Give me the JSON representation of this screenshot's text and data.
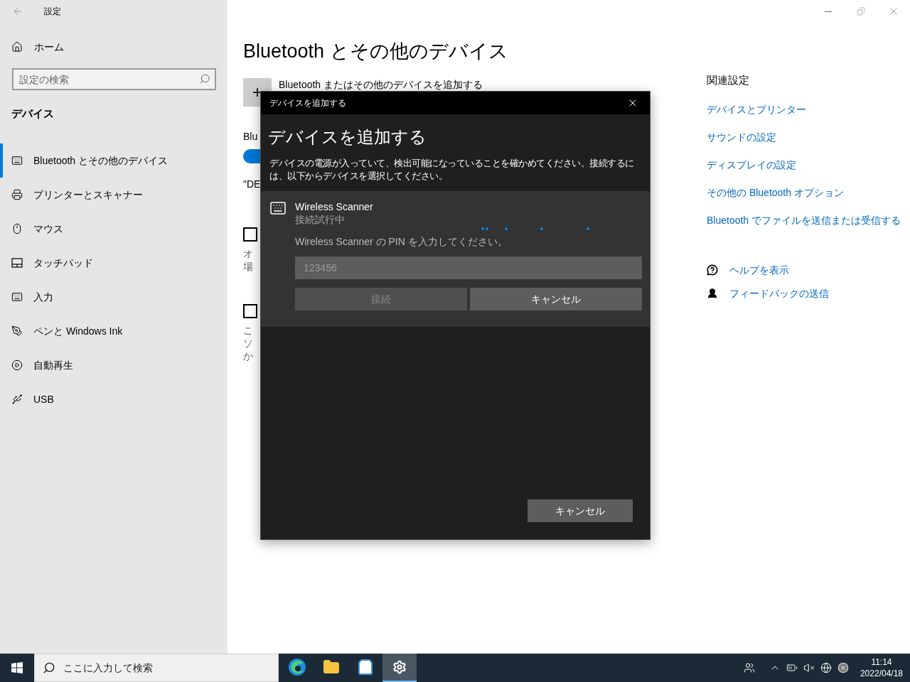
{
  "window": {
    "title": "設定"
  },
  "sidebar": {
    "home": "ホーム",
    "search": {
      "placeholder": "設定の検索"
    },
    "section": "デバイス",
    "items": [
      {
        "label": "Bluetooth とその他のデバイス",
        "selected": true
      },
      {
        "label": "プリンターとスキャナー",
        "selected": false
      },
      {
        "label": "マウス",
        "selected": false
      },
      {
        "label": "タッチパッド",
        "selected": false
      },
      {
        "label": "入力",
        "selected": false
      },
      {
        "label": "ペンと Windows Ink",
        "selected": false
      },
      {
        "label": "自動再生",
        "selected": false
      },
      {
        "label": "USB",
        "selected": false
      }
    ]
  },
  "main": {
    "title": "Bluetooth とその他のデバイス",
    "add_button": {
      "glyph": "+",
      "label": "Bluetooth またはその他のデバイスを追加する"
    },
    "bluetooth_label": "Blu",
    "bluetooth_toggle": {
      "on": true
    },
    "discoverable_text": "\"DE",
    "checkboxes": [
      {
        "checked": false,
        "lines": [
          "オ",
          "場"
        ]
      },
      {
        "checked": false,
        "lines": [
          "こ",
          "ソ",
          "か"
        ]
      }
    ]
  },
  "related": {
    "heading": "関連設定",
    "links": [
      "デバイスとプリンター",
      "サウンドの設定",
      "ディスプレイの設定",
      "その他の Bluetooth オプション",
      "Bluetooth でファイルを送信または受信する"
    ],
    "help": [
      "ヘルプを表示",
      "フィードバックの送信"
    ]
  },
  "dialog": {
    "title": "デバイスを追加する",
    "heading": "デバイスを追加する",
    "description": "デバイスの電源が入っていて、検出可能になっていることを確かめてください。接続するには、以下からデバイスを選択してください。",
    "device": {
      "name": "Wireless Scanner",
      "status": "接続試行中",
      "prompt": "Wireless Scanner の PIN を入力してください。",
      "pin": {
        "placeholder": "123456"
      },
      "buttons": [
        {
          "label": "接続",
          "disabled": true
        },
        {
          "label": "キャンセル",
          "disabled": false
        }
      ]
    },
    "cancel": "キャンセル"
  },
  "taskbar": {
    "search": {
      "placeholder": "ここに入力して検索"
    },
    "apps": [
      {
        "selected": false
      },
      {
        "selected": false
      },
      {
        "selected": false
      },
      {
        "selected": true
      }
    ],
    "clock": {
      "time": "11:14",
      "date": "2022/04/18"
    }
  }
}
